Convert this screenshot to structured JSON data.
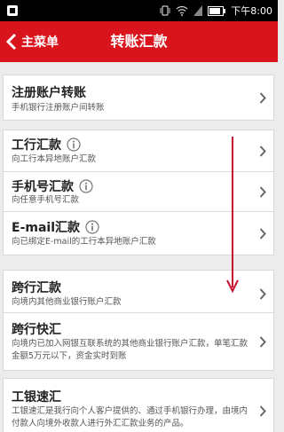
{
  "statusbar": {
    "carrier_label": "下午",
    "time": "8:00"
  },
  "header": {
    "back_label": "主菜单",
    "title": "转账汇款"
  },
  "items": [
    {
      "title": "注册账户转账",
      "subtitle": "手机银行注册账户间转账",
      "info": false
    },
    {
      "title": "工行汇款",
      "subtitle": "向工行本异地账户汇款",
      "info": true
    },
    {
      "title": "手机号汇款",
      "subtitle": "向任意手机号汇款",
      "info": true
    },
    {
      "title": "E-mail汇款",
      "subtitle": "向已绑定E-mail的工行本异地账户汇款",
      "info": true
    },
    {
      "title": "跨行汇款",
      "subtitle": "向境内其他商业银行账户汇款",
      "info": false
    },
    {
      "title": "跨行快汇",
      "subtitle": "向境内已加入网银互联系统的其他商业银行账户汇款，单笔汇款金额5万元以下，资金实时到账",
      "info": false
    },
    {
      "title": "工银速汇",
      "subtitle": "工银速汇是我行向个人客户提供的、通过手机银行办理，由境内付款人向境外收款人进行外汇汇款业务的产品。",
      "info": false
    }
  ],
  "colors": {
    "header_red": "#d9141c",
    "annotation_arrow": "#c8102e"
  }
}
